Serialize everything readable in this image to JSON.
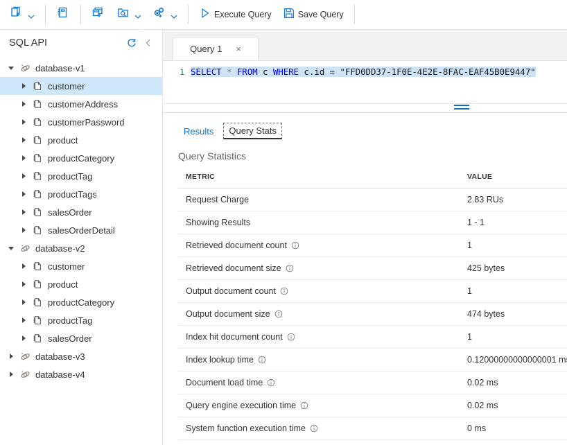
{
  "toolbar": {
    "groups": [
      [
        {
          "name": "new-container-button",
          "label": "",
          "icon": "new-container-icon",
          "caret": true
        }
      ],
      [
        {
          "name": "new-notebook-button",
          "label": "",
          "icon": "notebook-icon",
          "caret": false
        }
      ],
      [
        {
          "name": "new-sql-query-button",
          "label": "",
          "icon": "new-sql-query-icon",
          "caret": false
        },
        {
          "name": "open-query-button",
          "label": "",
          "icon": "open-query-icon",
          "caret": true
        },
        {
          "name": "new-stored-procedure-button",
          "label": "",
          "icon": "settings-plus-icon",
          "caret": true
        }
      ],
      [
        {
          "name": "execute-query-button",
          "label": "Execute Query",
          "icon": "play-icon",
          "caret": false
        },
        {
          "name": "save-query-button",
          "label": "Save Query",
          "icon": "save-icon",
          "caret": false
        }
      ]
    ]
  },
  "sidebar": {
    "title": "SQL API",
    "refresh_icon": "refresh-icon",
    "collapse_icon": "chevron-left-icon",
    "tree": [
      {
        "label": "database-v1",
        "type": "database",
        "expanded": true,
        "selected": false
      },
      {
        "label": "customer",
        "type": "container",
        "expanded": false,
        "selected": true
      },
      {
        "label": "customerAddress",
        "type": "container",
        "expanded": false,
        "selected": false
      },
      {
        "label": "customerPassword",
        "type": "container",
        "expanded": false,
        "selected": false
      },
      {
        "label": "product",
        "type": "container",
        "expanded": false,
        "selected": false
      },
      {
        "label": "productCategory",
        "type": "container",
        "expanded": false,
        "selected": false
      },
      {
        "label": "productTag",
        "type": "container",
        "expanded": false,
        "selected": false
      },
      {
        "label": "productTags",
        "type": "container",
        "expanded": false,
        "selected": false
      },
      {
        "label": "salesOrder",
        "type": "container",
        "expanded": false,
        "selected": false
      },
      {
        "label": "salesOrderDetail",
        "type": "container",
        "expanded": false,
        "selected": false
      },
      {
        "label": "database-v2",
        "type": "database",
        "expanded": true,
        "selected": false
      },
      {
        "label": "customer",
        "type": "container",
        "expanded": false,
        "selected": false
      },
      {
        "label": "product",
        "type": "container",
        "expanded": false,
        "selected": false
      },
      {
        "label": "productCategory",
        "type": "container",
        "expanded": false,
        "selected": false
      },
      {
        "label": "productTag",
        "type": "container",
        "expanded": false,
        "selected": false
      },
      {
        "label": "salesOrder",
        "type": "container",
        "expanded": false,
        "selected": false
      },
      {
        "label": "database-v3",
        "type": "database",
        "expanded": false,
        "selected": false
      },
      {
        "label": "database-v4",
        "type": "database",
        "expanded": false,
        "selected": false
      }
    ]
  },
  "editor": {
    "tab_label": "Query 1",
    "tab_close": "×",
    "line_number": "1",
    "query_tokens": [
      {
        "t": "SELECT",
        "c": "kw"
      },
      {
        "t": " ",
        "c": "plain"
      },
      {
        "t": "*",
        "c": "op"
      },
      {
        "t": " ",
        "c": "plain"
      },
      {
        "t": "FROM",
        "c": "kw"
      },
      {
        "t": " c ",
        "c": "plain"
      },
      {
        "t": "WHERE",
        "c": "kw"
      },
      {
        "t": " c.id = \"FFD0DD37-1F0E-4E2E-8FAC-EAF45B0E9447\"",
        "c": "plain"
      }
    ],
    "query_text": "SELECT * FROM c WHERE c.id = \"FFD0DD37-1F0E-4E2E-8FAC-EAF45B0E9447\""
  },
  "results_panel": {
    "tabs": [
      {
        "label": "Results",
        "active": false
      },
      {
        "label": "Query Stats",
        "active": true
      }
    ],
    "title": "Query Statistics",
    "columns": [
      "METRIC",
      "VALUE"
    ],
    "rows": [
      {
        "metric": "Request Charge",
        "info": false,
        "value": "2.83 RUs"
      },
      {
        "metric": "Showing Results",
        "info": false,
        "value": "1 - 1"
      },
      {
        "metric": "Retrieved document count",
        "info": true,
        "value": "1"
      },
      {
        "metric": "Retrieved document size",
        "info": true,
        "value": "425 bytes"
      },
      {
        "metric": "Output document count",
        "info": true,
        "value": "1"
      },
      {
        "metric": "Output document size",
        "info": true,
        "value": "474 bytes"
      },
      {
        "metric": "Index hit document count",
        "info": true,
        "value": "1"
      },
      {
        "metric": "Index lookup time",
        "info": true,
        "value": "0.12000000000000001 ms"
      },
      {
        "metric": "Document load time",
        "info": true,
        "value": "0.02 ms"
      },
      {
        "metric": "Query engine execution time",
        "info": true,
        "value": "0.02 ms"
      },
      {
        "metric": "System function execution time",
        "info": true,
        "value": "0 ms"
      }
    ]
  },
  "colors": {
    "accent": "#0078d4",
    "icon_blue": "#1a7fd4",
    "selection_blue": "#cfe8f9",
    "code_keyword": "#0000ff",
    "code_selection": "#cfe3f7",
    "gutter": "#237893"
  }
}
